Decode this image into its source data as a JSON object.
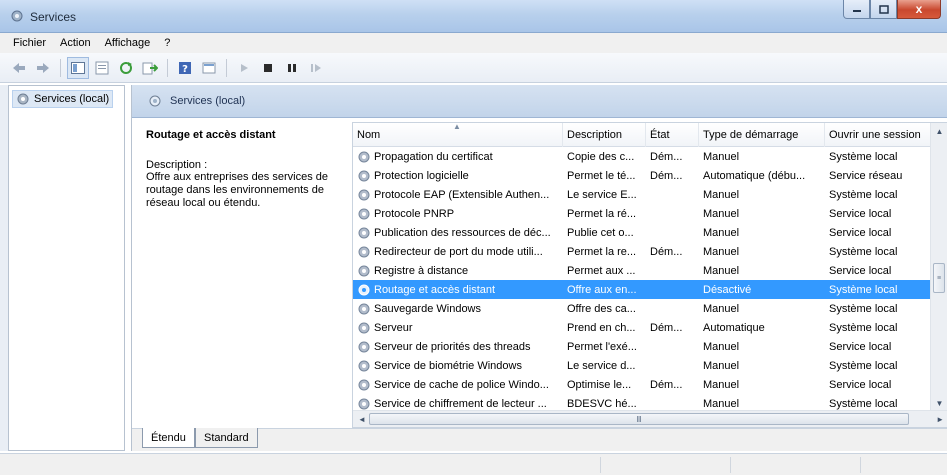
{
  "window": {
    "title": "Services",
    "minimize": "_",
    "maximize": "□",
    "close": "x"
  },
  "menu": [
    "Fichier",
    "Action",
    "Affichage",
    "?"
  ],
  "toolbar": {
    "icons": [
      "back-icon",
      "forward-icon",
      "show-hide-tree-icon",
      "properties-icon",
      "refresh-icon",
      "export-list-icon",
      "help-icon",
      "console-icon",
      "play-icon",
      "stop-icon",
      "pause-icon",
      "restart-icon"
    ]
  },
  "tree": {
    "item": "Services (local)"
  },
  "header": {
    "title": "Services (local)"
  },
  "description": {
    "title": "Routage et accès distant",
    "label": "Description :",
    "text": "Offre aux entreprises des services de routage dans les environnements de réseau local ou étendu."
  },
  "table": {
    "columns": [
      "Nom",
      "Description",
      "État",
      "Type de démarrage",
      "Ouvrir une session"
    ],
    "rows": [
      {
        "name": "Propagation du certificat",
        "description": "Copie des c...",
        "state": "Dém...",
        "startup": "Manuel",
        "logon": "Système local"
      },
      {
        "name": "Protection logicielle",
        "description": "Permet le té...",
        "state": "Dém...",
        "startup": "Automatique (débu...",
        "logon": "Service réseau"
      },
      {
        "name": "Protocole EAP (Extensible Authen...",
        "description": "Le service E...",
        "state": "",
        "startup": "Manuel",
        "logon": "Système local"
      },
      {
        "name": "Protocole PNRP",
        "description": "Permet la ré...",
        "state": "",
        "startup": "Manuel",
        "logon": "Service local"
      },
      {
        "name": "Publication des ressources de déc...",
        "description": "Publie cet o...",
        "state": "",
        "startup": "Manuel",
        "logon": "Service local"
      },
      {
        "name": "Redirecteur de port du mode utili...",
        "description": "Permet la re...",
        "state": "Dém...",
        "startup": "Manuel",
        "logon": "Système local"
      },
      {
        "name": "Registre à distance",
        "description": "Permet aux ...",
        "state": "",
        "startup": "Manuel",
        "logon": "Service local"
      },
      {
        "name": "Routage et accès distant",
        "description": "Offre aux en...",
        "state": "",
        "startup": "Désactivé",
        "logon": "Système local",
        "selected": true
      },
      {
        "name": "Sauvegarde Windows",
        "description": "Offre des ca...",
        "state": "",
        "startup": "Manuel",
        "logon": "Système local"
      },
      {
        "name": "Serveur",
        "description": "Prend en ch...",
        "state": "Dém...",
        "startup": "Automatique",
        "logon": "Système local"
      },
      {
        "name": "Serveur de priorités des threads",
        "description": "Permet l'exé...",
        "state": "",
        "startup": "Manuel",
        "logon": "Service local"
      },
      {
        "name": "Service de biométrie Windows",
        "description": "Le service d...",
        "state": "",
        "startup": "Manuel",
        "logon": "Système local"
      },
      {
        "name": "Service de cache de police Windo...",
        "description": "Optimise le...",
        "state": "Dém...",
        "startup": "Manuel",
        "logon": "Service local"
      },
      {
        "name": "Service de chiffrement de lecteur ...",
        "description": "BDESVC hé...",
        "state": "",
        "startup": "Manuel",
        "logon": "Système local"
      }
    ]
  },
  "tabs": {
    "extended": "Étendu",
    "standard": "Standard"
  },
  "colors": {
    "selection": "#3399ff",
    "header_bg": "#c2d4ea"
  }
}
